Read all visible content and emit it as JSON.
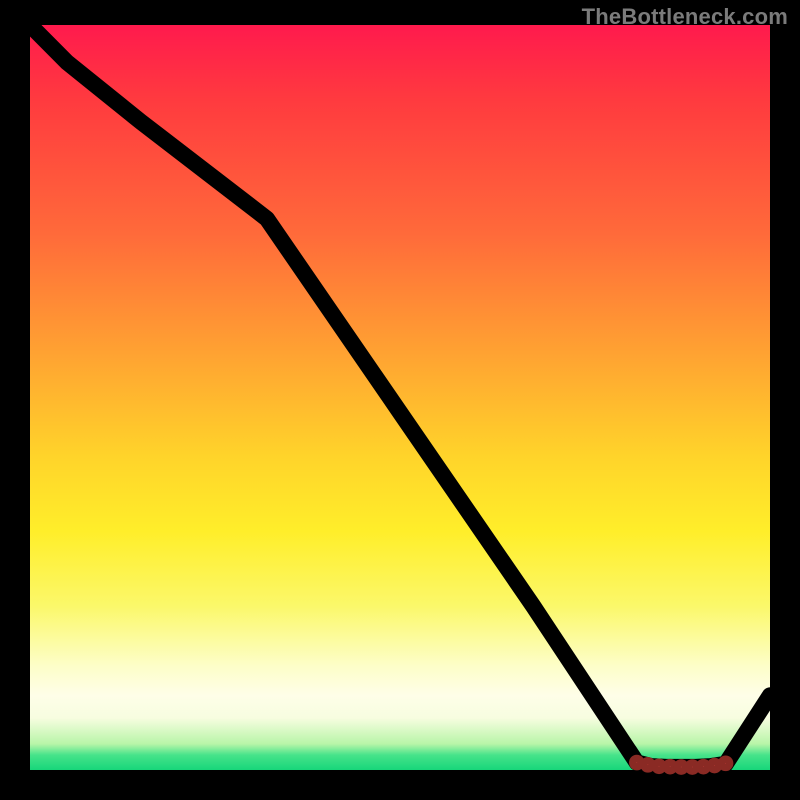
{
  "watermark": "TheBottleneck.com",
  "chart_data": {
    "type": "line",
    "title": "",
    "xlabel": "",
    "ylabel": "",
    "xlim": [
      0,
      100
    ],
    "ylim": [
      0,
      100
    ],
    "x": [
      0,
      5,
      15,
      32,
      50,
      68,
      82,
      84,
      86,
      88,
      90,
      92,
      94,
      100
    ],
    "values": [
      100,
      95,
      87,
      74,
      48,
      22,
      1,
      0.5,
      0.4,
      0.4,
      0.4,
      0.5,
      0.8,
      10
    ],
    "marker_points": {
      "x": [
        82,
        83.5,
        85,
        86.5,
        88,
        89.5,
        91,
        92.5,
        94
      ],
      "values": [
        1.0,
        0.7,
        0.5,
        0.45,
        0.4,
        0.4,
        0.45,
        0.6,
        0.9
      ]
    },
    "notes": "Black curve on a red→green vertical gradient background; cluster of small red dots along the trough near x≈82–94."
  }
}
